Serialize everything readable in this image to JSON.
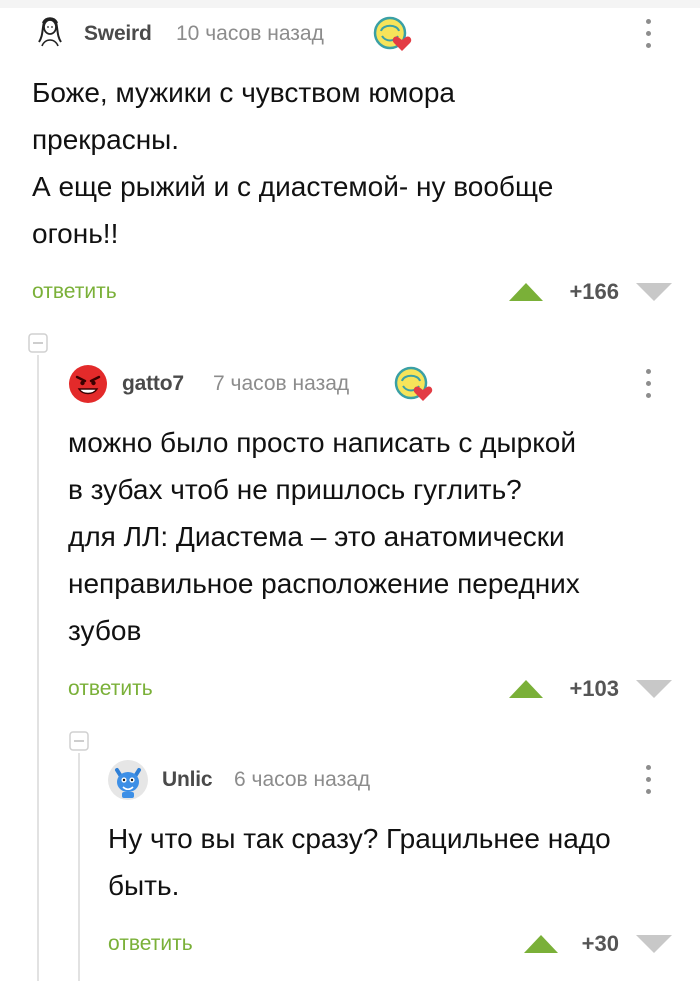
{
  "comments": [
    {
      "username": "Sweird",
      "time": "10 часов назад",
      "lines": [
        "Боже, мужики с чувством юмора",
        "прекрасны.",
        "А еще рыжий и с диастемой- ну вообще",
        "огонь!!"
      ],
      "reply_label": "ответить",
      "rating": "+166"
    },
    {
      "username": "gatto7",
      "time": "7 часов назад",
      "lines": [
        "можно было просто написать с дыркой",
        "в зубах чтоб не пришлось гуглить?",
        "для ЛЛ: Диастема – это анатомически",
        "неправильное расположение передних",
        "зубов"
      ],
      "reply_label": "ответить",
      "rating": "+103"
    },
    {
      "username": "Unlic",
      "time": "6 часов назад",
      "lines": [
        "Ну что вы так сразу? Грацильнее надо",
        "быть."
      ],
      "reply_label": "ответить",
      "rating": "+30"
    }
  ],
  "icons": {
    "avatar_1": "sketch-portrait-avatar",
    "avatar_2": "red-angry-face-avatar",
    "avatar_3": "blue-cat-avatar",
    "badge": "heart-badge-icon",
    "menu": "more-vertical-icon",
    "upvote": "triangle-up-icon",
    "downvote": "triangle-down-icon",
    "collapse": "minus-square-icon"
  },
  "colors": {
    "reply": "#7ab038",
    "upvote": "#7ab038",
    "downvote": "#c8c8c8",
    "username": "#4a4a4a",
    "time": "#8c8c8c",
    "text": "#111111"
  }
}
